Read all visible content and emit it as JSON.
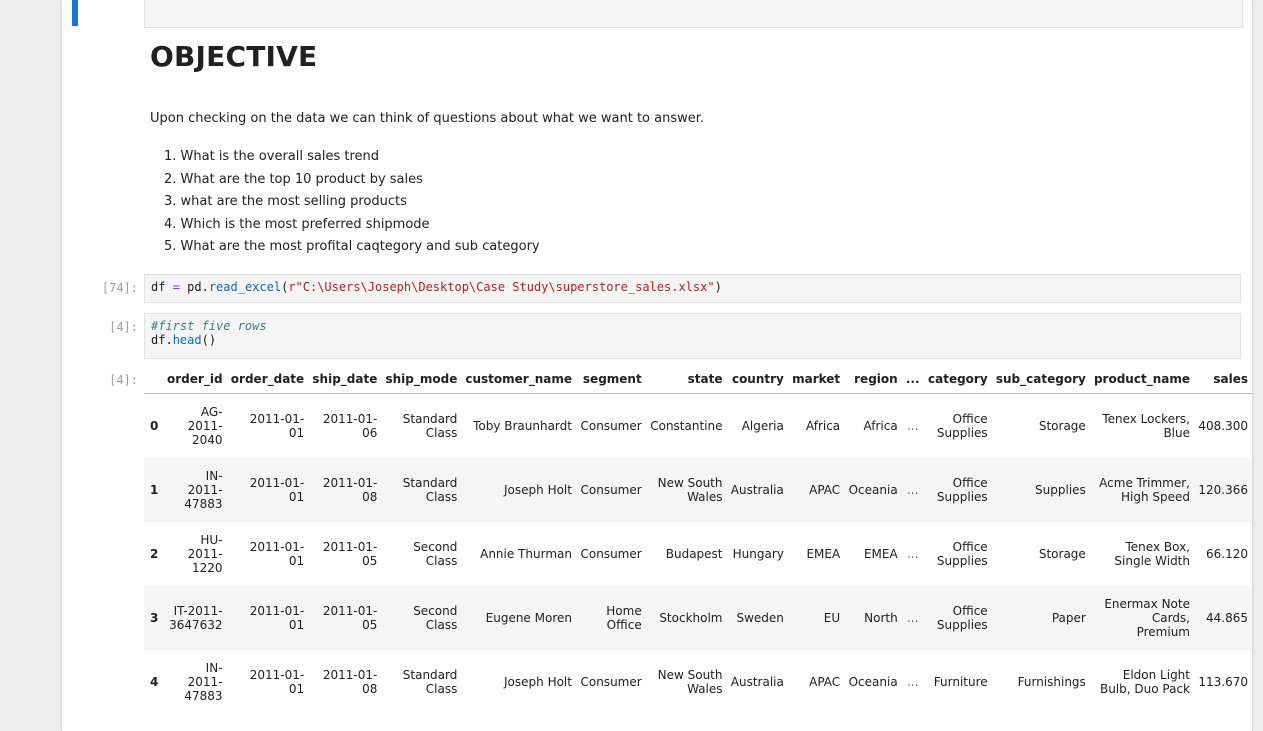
{
  "markdown": {
    "heading": "OBJECTIVE",
    "intro": "Upon checking on the data we can think of questions about what we want to answer.",
    "list": [
      "1. What is the overall sales trend",
      "2. What are the top 10 product by sales",
      "3. what are the most selling products",
      "4. Which is the most preferred shipmode",
      "5. What are the most profital caqtegory and sub category"
    ]
  },
  "cells": {
    "read_excel": {
      "prompt": "[74]:",
      "tokens": [
        "df",
        " = ",
        "pd",
        ".",
        "read_excel",
        "(",
        "r\"C:\\Users\\Joseph\\Desktop\\Case Study\\superstore_sales.xlsx\"",
        ")"
      ]
    },
    "head": {
      "prompt": "[4]:",
      "comment": "#first five rows",
      "tokens": [
        "df",
        ".",
        "head",
        "()"
      ]
    },
    "output_prompt": "[4]:"
  },
  "table": {
    "columns": [
      "",
      "order_id",
      "order_date",
      "ship_date",
      "ship_mode",
      "customer_name",
      "segment",
      "state",
      "country",
      "market",
      "region",
      "...",
      "category",
      "sub_category",
      "product_name",
      "sales"
    ],
    "rows": [
      [
        "0",
        "AG-\n2011-\n2040",
        "2011-01-\n01",
        "2011-01-\n06",
        "Standard\nClass",
        "Toby Braunhardt",
        "Consumer",
        "Constantine",
        "Algeria",
        "Africa",
        "Africa",
        "...",
        "Office\nSupplies",
        "Storage",
        "Tenex Lockers,\nBlue",
        "408.300"
      ],
      [
        "1",
        "IN-\n2011-\n47883",
        "2011-01-\n01",
        "2011-01-\n08",
        "Standard\nClass",
        "Joseph Holt",
        "Consumer",
        "New South\nWales",
        "Australia",
        "APAC",
        "Oceania",
        "...",
        "Office\nSupplies",
        "Supplies",
        "Acme Trimmer,\nHigh Speed",
        "120.366"
      ],
      [
        "2",
        "HU-\n2011-\n1220",
        "2011-01-\n01",
        "2011-01-\n05",
        "Second\nClass",
        "Annie Thurman",
        "Consumer",
        "Budapest",
        "Hungary",
        "EMEA",
        "EMEA",
        "...",
        "Office\nSupplies",
        "Storage",
        "Tenex Box,\nSingle Width",
        "66.120"
      ],
      [
        "3",
        "IT-2011-\n3647632",
        "2011-01-\n01",
        "2011-01-\n05",
        "Second\nClass",
        "Eugene Moren",
        "Home\nOffice",
        "Stockholm",
        "Sweden",
        "EU",
        "North",
        "...",
        "Office\nSupplies",
        "Paper",
        "Enermax Note\nCards,\nPremium",
        "44.865"
      ],
      [
        "4",
        "IN-\n2011-\n47883",
        "2011-01-\n01",
        "2011-01-\n08",
        "Standard\nClass",
        "Joseph Holt",
        "Consumer",
        "New South\nWales",
        "Australia",
        "APAC",
        "Oceania",
        "...",
        "Furniture",
        "Furnishings",
        "Eldon Light\nBulb, Duo Pack",
        "113.670"
      ]
    ]
  },
  "colors": {
    "selection_bar": "#1976d2",
    "code_background": "#f5f5f5",
    "string": "#ba2121",
    "function": "#1565c0",
    "operator": "#aa22ff",
    "comment": "#408080"
  }
}
